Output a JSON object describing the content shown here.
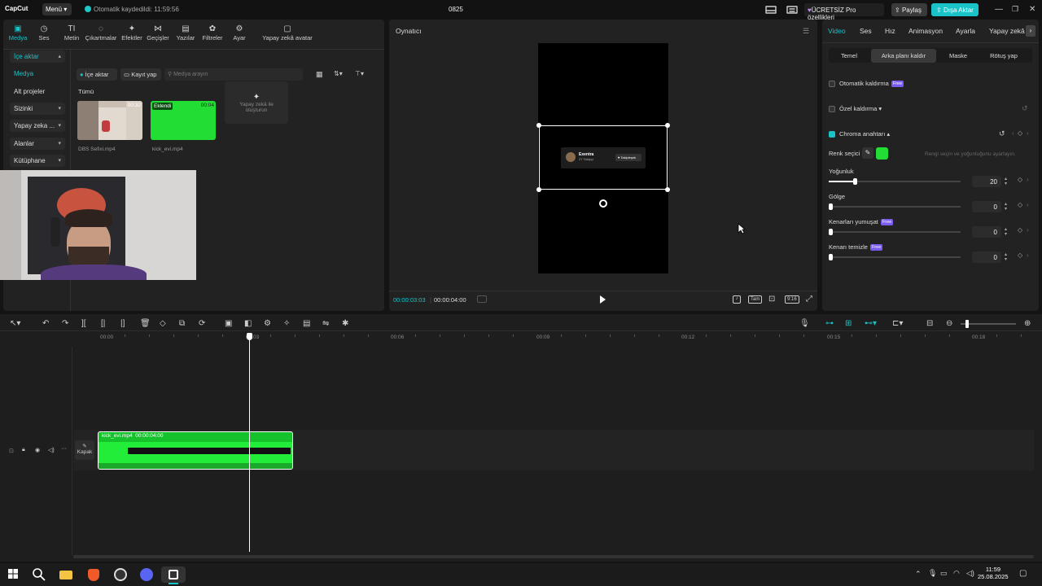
{
  "app": {
    "logo": "CapCut",
    "menu": "Menü",
    "autosave": "Otomatik kaydedildi: 11:59:56",
    "project": "0825"
  },
  "titlebar": {
    "pro": "ÜCRETSİZ Pro özellikleri",
    "share": "Paylaş",
    "export": "Dışa Aktar"
  },
  "toolbar": [
    "Medya",
    "Ses",
    "Metin",
    "Çıkartmalar",
    "Efektler",
    "Geçişler",
    "Yazılar",
    "Filtreler",
    "Ayar",
    "Yapay zekâ avatar"
  ],
  "sidebar": [
    "İçe aktar",
    "Medya",
    "Alt projeler",
    "Sizinki",
    "Yapay zeka ...",
    "Alanlar",
    "Kütüphane"
  ],
  "media": {
    "import_btn": "İçe aktar",
    "record_btn": "Kayıt yap",
    "search_placeholder": "Medya arayın",
    "filter_all": "Tümü",
    "items": [
      {
        "name": "DBS Sefixi.mp4",
        "duration": "00:32"
      },
      {
        "name": "kick_evi.mp4",
        "duration": "00:04",
        "badge": "Eklendi"
      }
    ],
    "ai_create": "Yapay zekâ ile oluşturun"
  },
  "player": {
    "title": "Oynatıcı",
    "current_time": "00:00:03:03",
    "total_time": "00:00:04:00",
    "full_label": "Tam",
    "ratio": "9:16",
    "overlay": {
      "name": "Exentra",
      "sub": "27 Takipçi",
      "follow": "Takipleşek"
    }
  },
  "props": {
    "tabs": [
      "Video",
      "Ses",
      "Hız",
      "Animasyon",
      "Ayarla",
      "Yapay zekâ"
    ],
    "subtabs": [
      "Temel",
      "Arka planı kaldır",
      "Maske",
      "Rötuş yap"
    ],
    "auto_remove": "Otomatik kaldırma",
    "custom_remove": "Özel kaldırma",
    "chroma": "Chroma anahtarı",
    "color_picker": "Renk seçici",
    "color_hint": "Rengi seçin ve yoğunluğunu ayarlayın.",
    "free_tag": "Free",
    "sliders": [
      {
        "label": "Yoğunluk",
        "value": "20",
        "level": 0.2,
        "free": false
      },
      {
        "label": "Gölge",
        "value": "0",
        "level": 0,
        "free": false
      },
      {
        "label": "Kenarları yumuşat",
        "value": "0",
        "level": 0,
        "free": true
      },
      {
        "label": "Kenarı temizle",
        "value": "0",
        "level": 0,
        "free": true
      }
    ],
    "chroma_color": "#22dd33"
  },
  "timeline": {
    "ruler": [
      "00:00",
      "00:03",
      "00:06",
      "00:09",
      "00:12",
      "00:15",
      "00:18"
    ],
    "clip_name": "kick_evi.mp4",
    "clip_duration": "00:00:04:00",
    "cover": "Kapak"
  },
  "taskbar": {
    "time": "11:59",
    "date": "25.08.2025"
  },
  "colors": {
    "accent": "#19c3c8",
    "green": "#22dd33",
    "free": "#7b5cf0"
  }
}
